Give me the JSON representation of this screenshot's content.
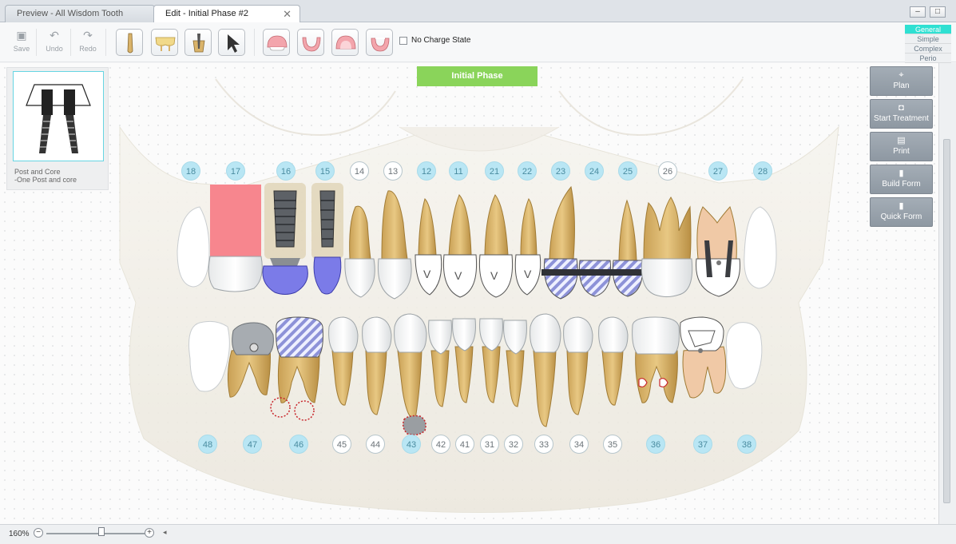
{
  "tabs": [
    {
      "label": "Preview - All Wisdom Tooth Removed",
      "active": false
    },
    {
      "label": "Edit - Initial Phase #2",
      "active": true
    }
  ],
  "window": {
    "minimize": "–",
    "maximize": "□"
  },
  "toolbar": {
    "save_label": "Save",
    "undo_label": "Undo",
    "redo_label": "Redo",
    "no_charge_label": "No Charge State"
  },
  "modes": [
    "General",
    "Simple",
    "Complex",
    "Perio"
  ],
  "active_mode": "General",
  "phase_banner": "Initial Phase",
  "info_card": {
    "line1": "Post and Core",
    "line2": "-One Post and  core"
  },
  "actions": [
    {
      "label": "Plan",
      "icon": "target-icon"
    },
    {
      "label": "Start Treatment",
      "icon": "tooth-icon"
    },
    {
      "label": "Print",
      "icon": "printer-icon"
    },
    {
      "label": "Build Form",
      "icon": "clipboard-icon"
    },
    {
      "label": "Quick Form",
      "icon": "clipboard-icon"
    }
  ],
  "upper_teeth": [
    {
      "num": "18",
      "style": "blue"
    },
    {
      "num": "17",
      "style": "blue"
    },
    {
      "num": "16",
      "style": "blue"
    },
    {
      "num": "15",
      "style": "blue"
    },
    {
      "num": "14",
      "style": "white"
    },
    {
      "num": "13",
      "style": "white"
    },
    {
      "num": "12",
      "style": "blue"
    },
    {
      "num": "11",
      "style": "blue"
    },
    {
      "num": "21",
      "style": "blue"
    },
    {
      "num": "22",
      "style": "blue"
    },
    {
      "num": "23",
      "style": "blue"
    },
    {
      "num": "24",
      "style": "blue"
    },
    {
      "num": "25",
      "style": "blue"
    },
    {
      "num": "26",
      "style": "white"
    },
    {
      "num": "27",
      "style": "blue"
    },
    {
      "num": "28",
      "style": "blue"
    }
  ],
  "lower_teeth": [
    {
      "num": "48",
      "style": "blue"
    },
    {
      "num": "47",
      "style": "blue"
    },
    {
      "num": "46",
      "style": "blue"
    },
    {
      "num": "45",
      "style": "white"
    },
    {
      "num": "44",
      "style": "white"
    },
    {
      "num": "43",
      "style": "blue"
    },
    {
      "num": "42",
      "style": "white"
    },
    {
      "num": "41",
      "style": "white"
    },
    {
      "num": "31",
      "style": "white"
    },
    {
      "num": "32",
      "style": "white"
    },
    {
      "num": "33",
      "style": "white"
    },
    {
      "num": "34",
      "style": "white"
    },
    {
      "num": "35",
      "style": "white"
    },
    {
      "num": "36",
      "style": "blue"
    },
    {
      "num": "37",
      "style": "blue"
    },
    {
      "num": "38",
      "style": "blue"
    }
  ],
  "veneer_mark": "V",
  "zoom": {
    "label": "160%",
    "minus": "−",
    "plus": "+",
    "level": 0.56
  },
  "colors": {
    "accent": "#2fe0d2",
    "banner": "#8ad45a",
    "badge_blue": "#b9e6f4",
    "extraction": "#f7868e",
    "implant_crown": "#7b7be8"
  }
}
